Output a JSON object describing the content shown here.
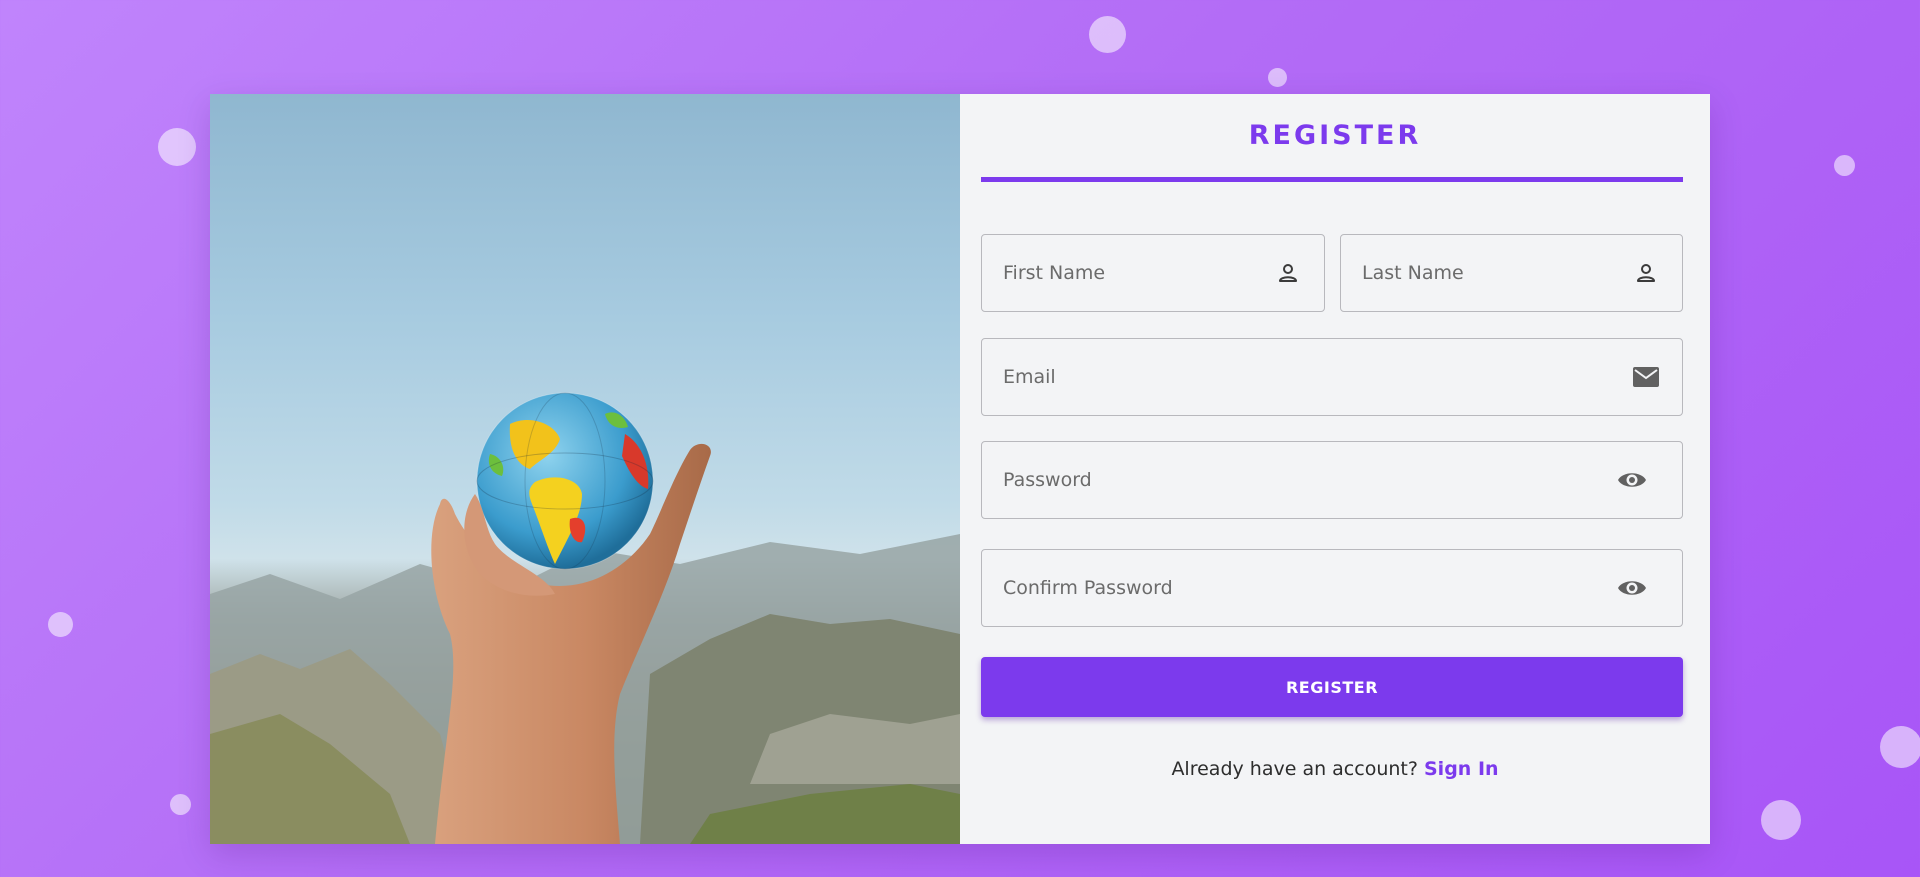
{
  "form": {
    "title": "REGISTER",
    "fields": {
      "first_name": {
        "placeholder": "First Name",
        "icon": "person-icon"
      },
      "last_name": {
        "placeholder": "Last Name",
        "icon": "person-icon"
      },
      "email": {
        "placeholder": "Email",
        "icon": "mail-icon"
      },
      "password": {
        "placeholder": "Password",
        "icon": "eye-icon"
      },
      "confirm_password": {
        "placeholder": "Confirm Password",
        "icon": "eye-icon"
      }
    },
    "submit_label": "REGISTER",
    "signin_prompt": "Already have an account?",
    "signin_link": "Sign In"
  },
  "colors": {
    "accent": "#7c3aed",
    "background": "#b36cf6",
    "panel": "#f3f4f6",
    "text": "#2d2d2d",
    "placeholder": "#6b6b6b"
  }
}
